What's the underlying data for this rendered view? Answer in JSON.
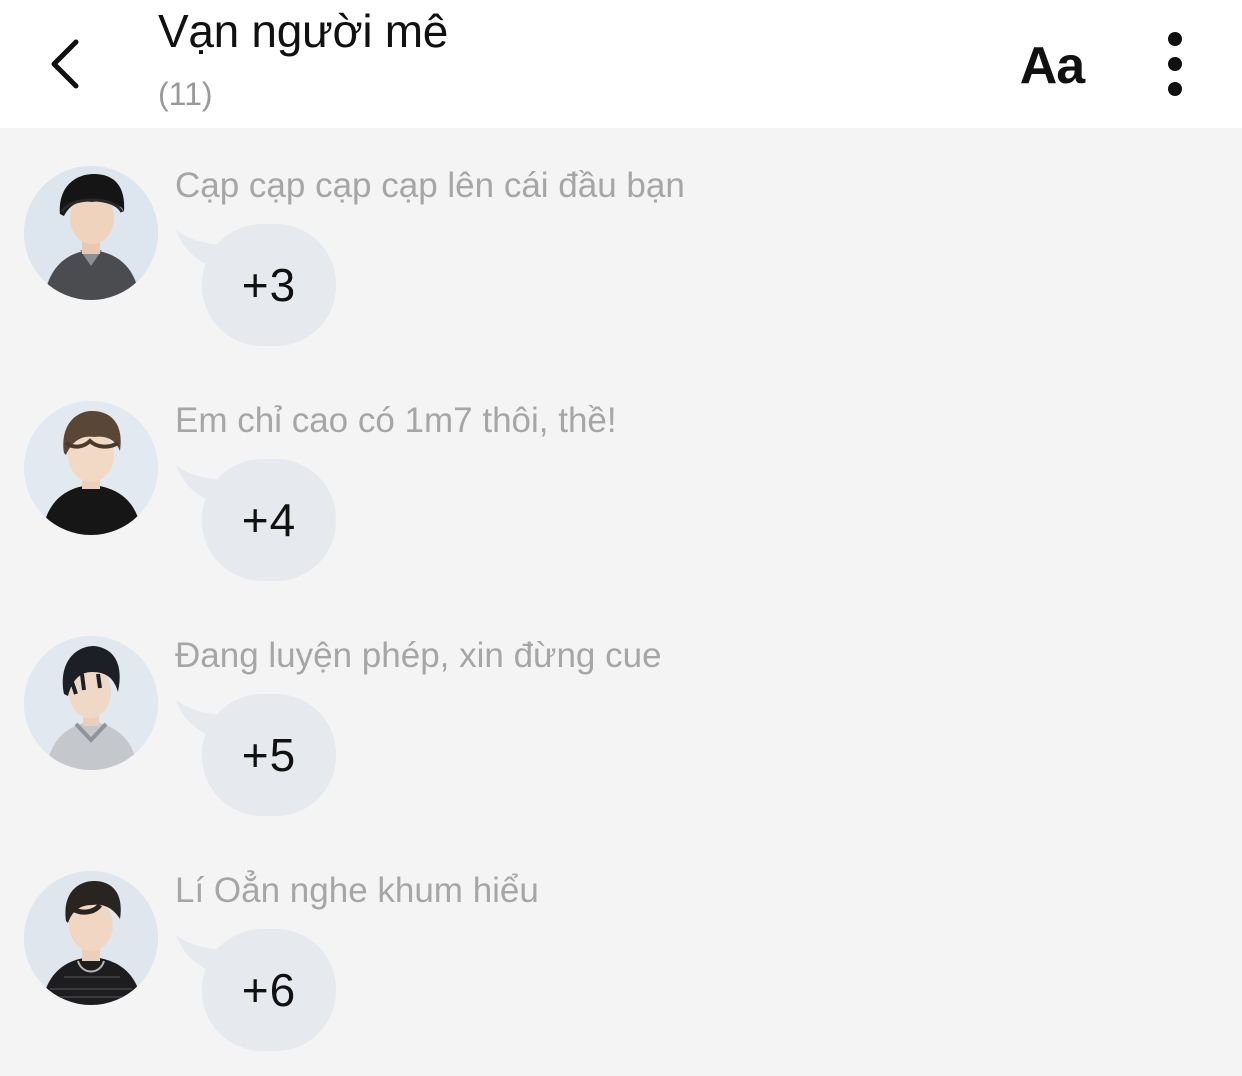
{
  "header": {
    "back_icon": "chevron-left-icon",
    "title": "Vạn người mê",
    "member_count": "(11)",
    "font_button_label": "Aa",
    "more_icon": "more-vertical-icon"
  },
  "messages": [
    {
      "sender": "Cạp cạp cạp cạp lên cái đầu bạn",
      "text": "+3",
      "avatar": "avatar-beanie"
    },
    {
      "sender": "Em chỉ cao có 1m7 thôi, thề!",
      "text": "+4",
      "avatar": "avatar-brown-hair"
    },
    {
      "sender": "Đang luyện phép, xin đừng cue",
      "text": "+5",
      "avatar": "avatar-black-hair"
    },
    {
      "sender": "Lí Oẳn nghe khum hiểu",
      "text": "+6",
      "avatar": "avatar-necklace"
    }
  ],
  "colors": {
    "background": "#f4f4f4",
    "header_background": "#ffffff",
    "bubble": "#e6e9ed",
    "sender_name": "#a6a6a6",
    "muted": "#999999"
  }
}
